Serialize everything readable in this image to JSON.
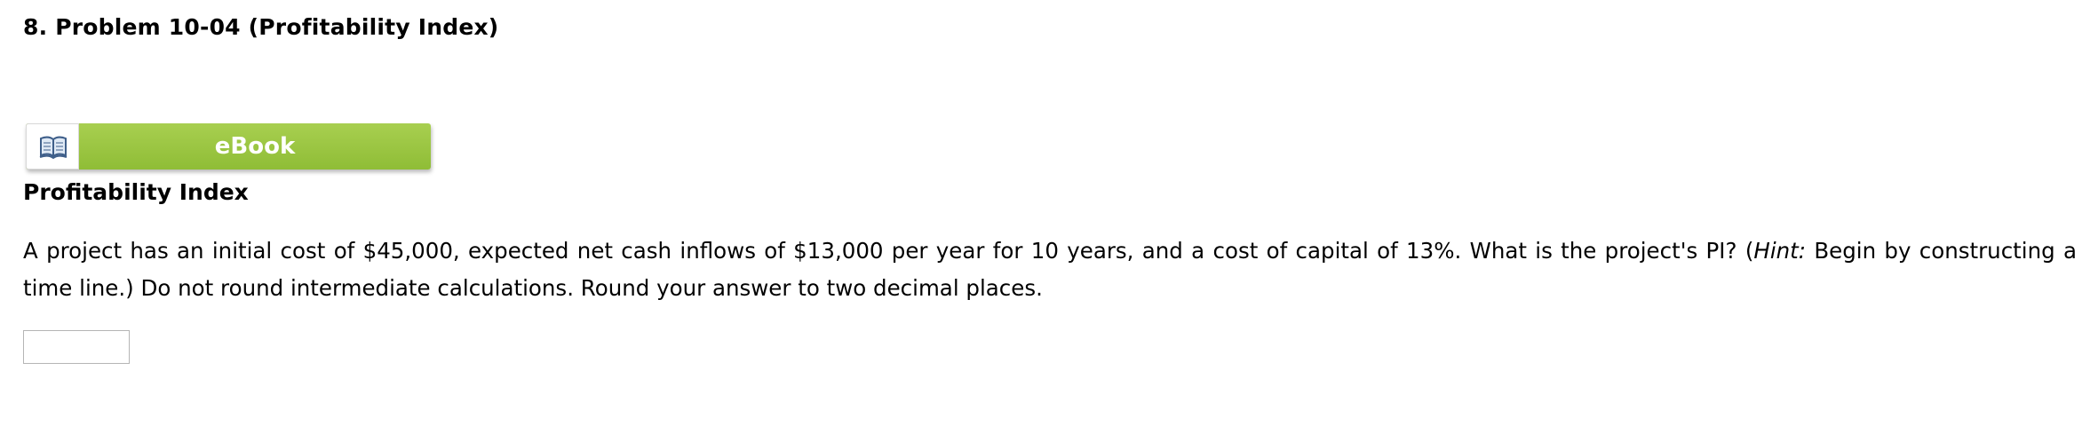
{
  "problem": {
    "number_title": "8.  Problem 10-04 (Profitability Index)"
  },
  "ebook": {
    "label": "eBook",
    "icon": "book-icon"
  },
  "section": {
    "heading": "Profitability Index"
  },
  "question": {
    "part1": "A project has an initial cost of $45,000, expected net cash inflows of $13,000 per year for 10 years, and a cost of capital of 13%. What is the project's PI? (",
    "hint_label": "Hint:",
    "part2": " Begin by constructing a time line.) Do not round intermediate calculations. Round your answer to two decimal places."
  },
  "answer": {
    "value": "",
    "placeholder": ""
  },
  "colors": {
    "ebook_green": "#9cc744",
    "input_border": "#b5b5b5"
  }
}
